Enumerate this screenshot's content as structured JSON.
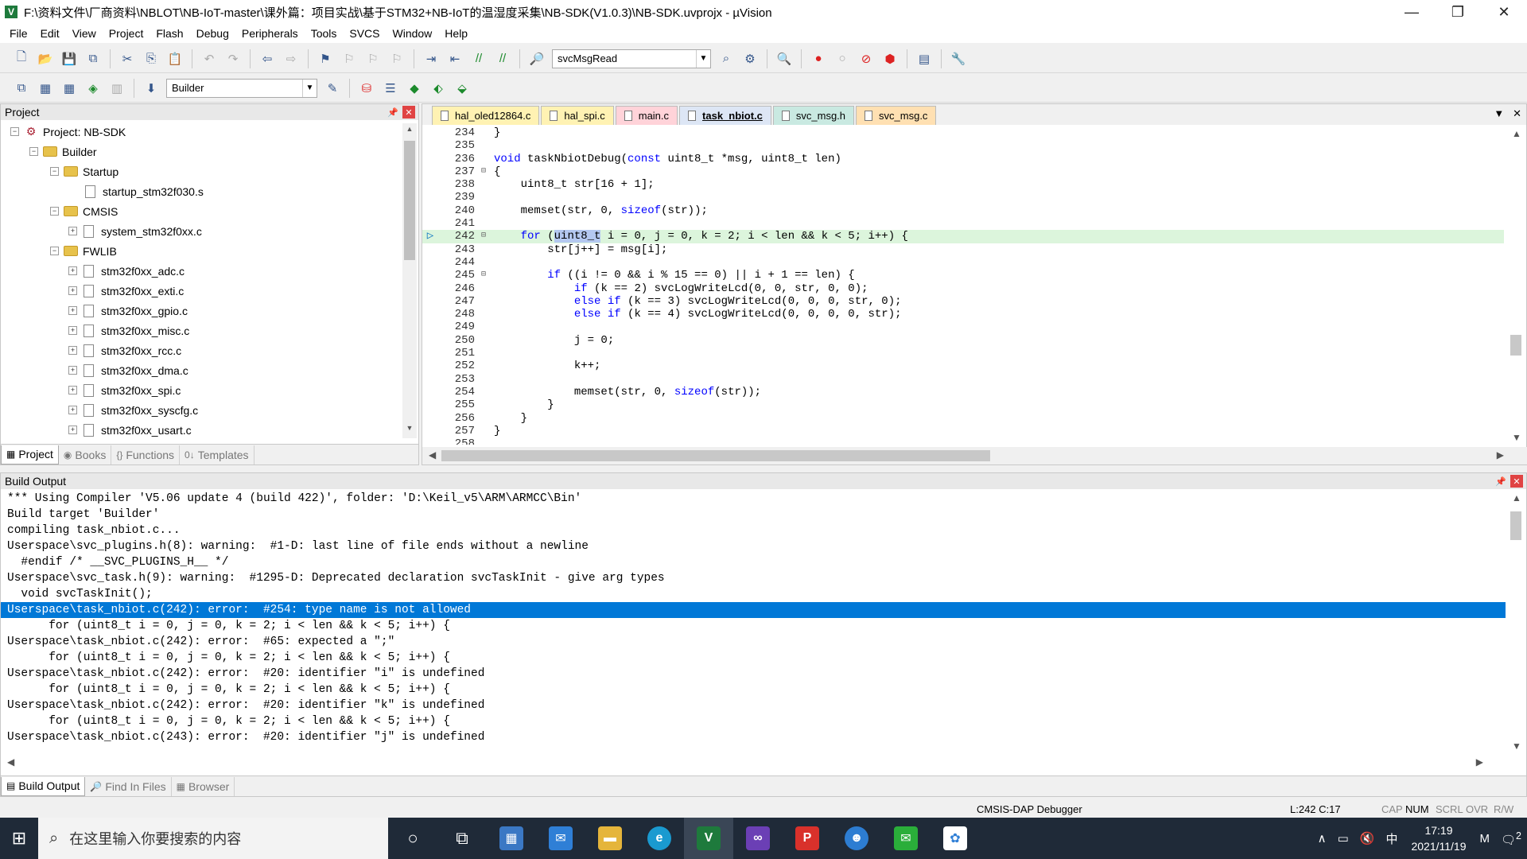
{
  "window": {
    "title": "F:\\资料文件\\厂商资料\\NBLOT\\NB-IoT-master\\课外篇：项目实战\\基于STM32+NB-IoT的温湿度采集\\NB-SDK(V1.0.3)\\NB-SDK.uvprojx - µVision",
    "minimize": "—",
    "maximize": "❐",
    "close": "✕"
  },
  "menu": [
    "File",
    "Edit",
    "View",
    "Project",
    "Flash",
    "Debug",
    "Peripherals",
    "Tools",
    "SVCS",
    "Window",
    "Help"
  ],
  "toolbar": {
    "find_combo": "svcMsgRead",
    "target_combo": "Builder"
  },
  "project_panel": {
    "title": "Project",
    "pin": "📌",
    "close": "✕",
    "tree": [
      {
        "label": "Project: NB-SDK",
        "kind": "project"
      },
      {
        "label": "Builder",
        "kind": "folder"
      },
      {
        "label": "Startup",
        "kind": "folder"
      },
      {
        "label": "startup_stm32f030.s",
        "kind": "file"
      },
      {
        "label": "CMSIS",
        "kind": "folder"
      },
      {
        "label": "system_stm32f0xx.c",
        "kind": "file"
      },
      {
        "label": "FWLIB",
        "kind": "folder"
      },
      {
        "label": "stm32f0xx_adc.c",
        "kind": "file"
      },
      {
        "label": "stm32f0xx_exti.c",
        "kind": "file"
      },
      {
        "label": "stm32f0xx_gpio.c",
        "kind": "file"
      },
      {
        "label": "stm32f0xx_misc.c",
        "kind": "file"
      },
      {
        "label": "stm32f0xx_rcc.c",
        "kind": "file"
      },
      {
        "label": "stm32f0xx_dma.c",
        "kind": "file"
      },
      {
        "label": "stm32f0xx_spi.c",
        "kind": "file"
      },
      {
        "label": "stm32f0xx_syscfg.c",
        "kind": "file"
      },
      {
        "label": "stm32f0xx_usart.c",
        "kind": "file"
      }
    ],
    "tabs": [
      "Project",
      "Books",
      "Functions",
      "Templates"
    ]
  },
  "editor": {
    "tabs": [
      {
        "label": "hal_oled12864.c",
        "color": "#fff2b3"
      },
      {
        "label": "hal_spi.c",
        "color": "#fff2b3"
      },
      {
        "label": "main.c",
        "color": "#ffd3d9"
      },
      {
        "label": "task_nbiot.c",
        "color": "#dde6f5"
      },
      {
        "label": "svc_msg.h",
        "color": "#c9e9e1"
      },
      {
        "label": "svc_msg.c",
        "color": "#ffe0b2"
      }
    ],
    "active_tab": "task_nbiot.c",
    "lines": [
      {
        "n": "234",
        "t": "}"
      },
      {
        "n": "235",
        "t": ""
      },
      {
        "n": "236",
        "t": "void taskNbiotDebug(const uint8_t *msg, uint8_t len)"
      },
      {
        "n": "237",
        "t": "{"
      },
      {
        "n": "238",
        "t": "    uint8_t str[16 + 1];"
      },
      {
        "n": "239",
        "t": ""
      },
      {
        "n": "240",
        "t": "    memset(str, 0, sizeof(str));"
      },
      {
        "n": "241",
        "t": ""
      },
      {
        "n": "242",
        "t": "    for (uint8_t i = 0, j = 0, k = 2; i < len && k < 5; i++) {"
      },
      {
        "n": "243",
        "t": "        str[j++] = msg[i];"
      },
      {
        "n": "244",
        "t": ""
      },
      {
        "n": "245",
        "t": "        if ((i != 0 && i % 15 == 0) || i + 1 == len) {"
      },
      {
        "n": "246",
        "t": "            if (k == 2) svcLogWriteLcd(0, 0, str, 0, 0);"
      },
      {
        "n": "247",
        "t": "            else if (k == 3) svcLogWriteLcd(0, 0, 0, str, 0);"
      },
      {
        "n": "248",
        "t": "            else if (k == 4) svcLogWriteLcd(0, 0, 0, 0, str);"
      },
      {
        "n": "249",
        "t": ""
      },
      {
        "n": "250",
        "t": "            j = 0;"
      },
      {
        "n": "251",
        "t": ""
      },
      {
        "n": "252",
        "t": "            k++;"
      },
      {
        "n": "253",
        "t": ""
      },
      {
        "n": "254",
        "t": "            memset(str, 0, sizeof(str));"
      },
      {
        "n": "255",
        "t": "        }"
      },
      {
        "n": "256",
        "t": "    }"
      },
      {
        "n": "257",
        "t": "}"
      },
      {
        "n": "258",
        "t": ""
      }
    ]
  },
  "build_output": {
    "title": "Build Output",
    "lines": [
      "*** Using Compiler 'V5.06 update 4 (build 422)', folder: 'D:\\Keil_v5\\ARM\\ARMCC\\Bin'",
      "Build target 'Builder'",
      "compiling task_nbiot.c...",
      "Userspace\\svc_plugins.h(8): warning:  #1-D: last line of file ends without a newline",
      "  #endif /* __SVC_PLUGINS_H__ */",
      "Userspace\\svc_task.h(9): warning:  #1295-D: Deprecated declaration svcTaskInit - give arg types",
      "  void svcTaskInit();",
      "Userspace\\task_nbiot.c(242): error:  #254: type name is not allowed",
      "      for (uint8_t i = 0, j = 0, k = 2; i < len && k < 5; i++) {",
      "Userspace\\task_nbiot.c(242): error:  #65: expected a \";\"",
      "      for (uint8_t i = 0, j = 0, k = 2; i < len && k < 5; i++) {",
      "Userspace\\task_nbiot.c(242): error:  #20: identifier \"i\" is undefined",
      "      for (uint8_t i = 0, j = 0, k = 2; i < len && k < 5; i++) {",
      "Userspace\\task_nbiot.c(242): error:  #20: identifier \"k\" is undefined",
      "      for (uint8_t i = 0, j = 0, k = 2; i < len && k < 5; i++) {",
      "Userspace\\task_nbiot.c(243): error:  #20: identifier \"j\" is undefined"
    ],
    "highlighted_index": 7,
    "tabs": [
      "Build Output",
      "Find In Files",
      "Browser"
    ]
  },
  "status": {
    "debugger": "CMSIS-DAP Debugger",
    "position": "L:242 C:17",
    "caps": "CAP",
    "num": "NUM",
    "scrl": "SCRL",
    "ovr": "OVR",
    "rw": "R/W"
  },
  "taskbar": {
    "search_placeholder": "在这里输入你要搜索的内容",
    "ime": "中",
    "time": "17:19",
    "date": "2021/11/19",
    "notif_count": "2"
  }
}
